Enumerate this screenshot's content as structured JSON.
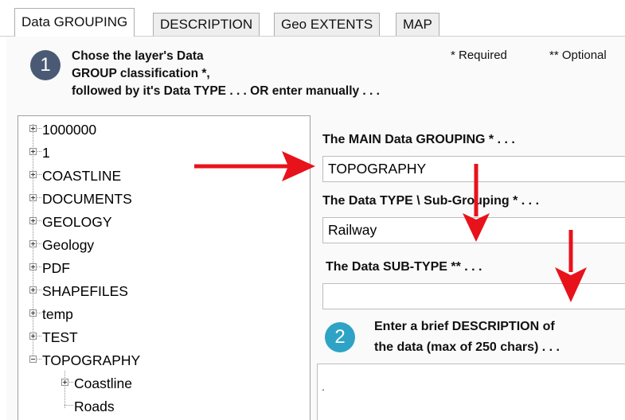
{
  "tabs": [
    {
      "label": "Data GROUPING",
      "active": true
    },
    {
      "label": "DESCRIPTION",
      "active": false
    },
    {
      "label": "Geo EXTENTS",
      "active": false
    },
    {
      "label": "MAP",
      "active": false
    }
  ],
  "step1": {
    "number": "1",
    "lines": [
      "Chose the layer's Data",
      "GROUP classification *,",
      "followed by it's Data TYPE . . .  OR  enter manually . . ."
    ],
    "required_note": "* Required",
    "optional_note": "** Optional"
  },
  "tree": {
    "items": [
      {
        "label": "1000000",
        "expander": "plus"
      },
      {
        "label": "1",
        "expander": "plus"
      },
      {
        "label": "COASTLINE",
        "expander": "plus"
      },
      {
        "label": "DOCUMENTS",
        "expander": "plus"
      },
      {
        "label": "GEOLOGY",
        "expander": "plus"
      },
      {
        "label": "Geology",
        "expander": "plus"
      },
      {
        "label": "PDF",
        "expander": "plus"
      },
      {
        "label": "SHAPEFILES",
        "expander": "plus"
      },
      {
        "label": "temp",
        "expander": "plus"
      },
      {
        "label": "TEST",
        "expander": "plus"
      },
      {
        "label": "TOPOGRAPHY",
        "expander": "minus"
      }
    ],
    "children": [
      {
        "label": "Coastline",
        "expander": "plus"
      },
      {
        "label": "Roads",
        "expander": "none"
      }
    ]
  },
  "fields": {
    "main_grouping": {
      "label": "The MAIN Data GROUPING * . . .",
      "value": "TOPOGRAPHY"
    },
    "data_type": {
      "label": "The Data TYPE \\ Sub-Grouping * . . .",
      "value": "Railway"
    },
    "sub_type": {
      "label": "The Data SUB-TYPE ** . . .",
      "value": ""
    }
  },
  "step2": {
    "number": "2",
    "lines": [
      "Enter a brief DESCRIPTION of",
      "the data (max of 250 chars) . . ."
    ],
    "description_value": "."
  },
  "colors": {
    "badge1": "#4a5a75",
    "badge2": "#2ea3c6",
    "arrow": "#e8121b"
  }
}
